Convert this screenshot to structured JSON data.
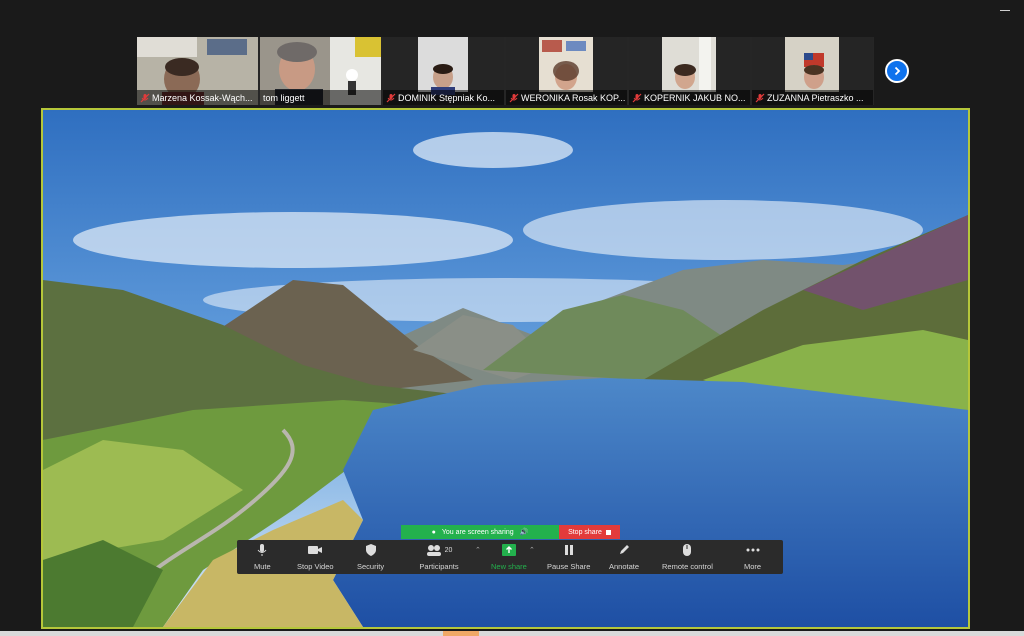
{
  "participants": [
    {
      "name": "Marzena Kossak-Wąch...",
      "muted": true,
      "active": false,
      "bg": "#a7a59a"
    },
    {
      "name": "tom liggett",
      "muted": false,
      "active": true,
      "bg": "#8f8a80"
    },
    {
      "name": "DOMINIK Stępniak Ko...",
      "muted": true,
      "active": false,
      "bg": "#cfcfcf"
    },
    {
      "name": "WERONIKA Rosak KOP...",
      "muted": true,
      "active": false,
      "bg": "#d8d2c8"
    },
    {
      "name": "KOPERNIK JAKUB NO...",
      "muted": true,
      "active": false,
      "bg": "#d9d8d2"
    },
    {
      "name": "ZUZANNA Pietraszko ...",
      "muted": true,
      "active": false,
      "bg": "#d0cdc3"
    }
  ],
  "sharing_banner": {
    "text": "You are screen sharing",
    "stop_label": "Stop share"
  },
  "toolbar": {
    "mute": "Mute",
    "stop_video": "Stop Video",
    "security": "Security",
    "participants": "Participants",
    "participants_count": "20",
    "new_share": "New share",
    "pause_share": "Pause Share",
    "annotate": "Annotate",
    "remote_control": "Remote control",
    "more": "More"
  },
  "colors": {
    "accent_blue": "#0e72ed",
    "active_speaker": "#28d17c",
    "share_border": "#b5c73a",
    "sharing_green": "#23b14d",
    "stop_red": "#e23b3b"
  }
}
